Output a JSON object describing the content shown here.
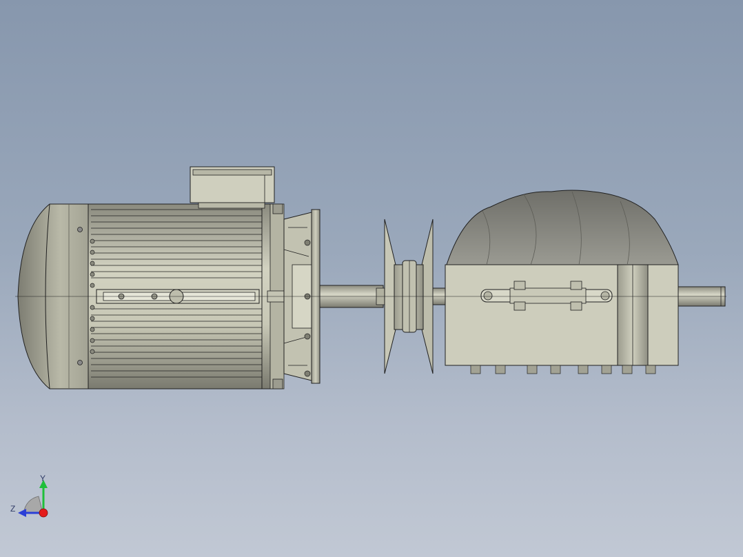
{
  "viewport": {
    "background_top": "#8797ad",
    "background_bottom": "#c1c8d4"
  },
  "model": {
    "components": [
      "motor-housing-icon",
      "terminal-box-icon",
      "motor-flange-icon",
      "shaft-icon",
      "pulley-icon",
      "gearbox-body-icon",
      "gearbox-cover-icon",
      "output-shaft-icon"
    ],
    "body_color": "#c9c9b8",
    "cover_color": "#8a8a84",
    "edge_color": "#1f1f1f"
  },
  "triad": {
    "y_label": "Y",
    "z_label": "Z",
    "y_color": "#1fbf3a",
    "z_color": "#2b3fd6",
    "origin_color": "#e41b1b"
  }
}
